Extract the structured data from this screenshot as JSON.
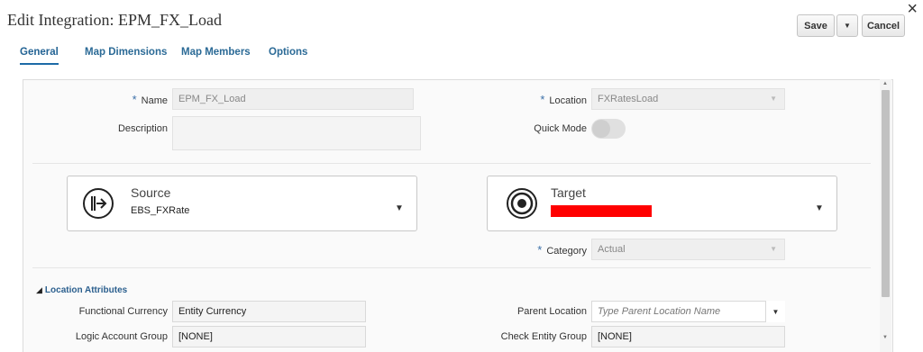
{
  "window": {
    "title": "Edit Integration: EPM_FX_Load",
    "close_glyph": "×"
  },
  "toolbar": {
    "save_label": "Save",
    "menu_glyph": "▼",
    "cancel_label": "Cancel"
  },
  "tabs": [
    {
      "label": "General",
      "active": true
    },
    {
      "label": "Map Dimensions",
      "active": false
    },
    {
      "label": "Map Members",
      "active": false
    },
    {
      "label": "Options",
      "active": false
    }
  ],
  "form": {
    "required_marker": "*",
    "name": {
      "label": "Name",
      "value": "EPM_FX_Load"
    },
    "description": {
      "label": "Description",
      "value": ""
    },
    "location": {
      "label": "Location",
      "value": "FXRatesLoad"
    },
    "quick_mode": {
      "label": "Quick Mode",
      "on": false
    },
    "source": {
      "title": "Source",
      "value": "EBS_FXRate",
      "icon": "source-arrow-icon"
    },
    "target": {
      "title": "Target",
      "value_redacted": true,
      "icon": "target-icon"
    },
    "category": {
      "label": "Category",
      "value": "Actual"
    },
    "dropdown_glyph": "▼"
  },
  "location_attributes": {
    "header": "Location Attributes",
    "toggle_glyph": "◢",
    "functional_currency": {
      "label": "Functional Currency",
      "value": "Entity Currency"
    },
    "parent_location": {
      "label": "Parent Location",
      "placeholder": "Type Parent Location Name"
    },
    "logic_account_group": {
      "label": "Logic Account Group",
      "value": "[NONE]"
    },
    "check_entity_group": {
      "label": "Check Entity Group",
      "value": "[NONE]"
    }
  },
  "scrollbar": {
    "up_glyph": "▲",
    "down_glyph": "▼"
  },
  "colors": {
    "accent": "#1d6ba7",
    "redaction": "#ff0000",
    "required": "#3b6fa8"
  }
}
